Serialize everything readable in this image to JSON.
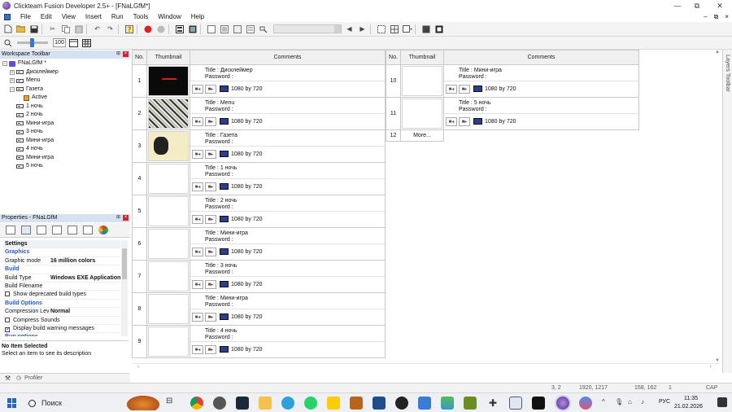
{
  "window": {
    "title": "Clickteam Fusion Developer 2.5+ - [FNaLGfM*]",
    "controls": {
      "minimize": "—",
      "restore": "⧉",
      "close": "✕"
    }
  },
  "menu": [
    "File",
    "Edit",
    "View",
    "Insert",
    "Run",
    "Tools",
    "Window",
    "Help"
  ],
  "mdi_controls": {
    "minimize": "–",
    "restore": "⧉",
    "close": "×"
  },
  "toolbar2": {
    "zoom_value": "100"
  },
  "workspace": {
    "title": "Workspace Toolbar",
    "tree": [
      {
        "label": "FNaLGfM *",
        "type": "app",
        "expander": "−",
        "indent": 0
      },
      {
        "label": "Дисклеймер",
        "type": "frame",
        "expander": "+",
        "indent": 1
      },
      {
        "label": "Menu",
        "type": "frame",
        "expander": "+",
        "indent": 1
      },
      {
        "label": "Газета",
        "type": "frame",
        "expander": "−",
        "indent": 1
      },
      {
        "label": "Active",
        "type": "active",
        "expander": "",
        "indent": 2
      },
      {
        "label": "1 ночь",
        "type": "frame",
        "expander": "",
        "indent": 1
      },
      {
        "label": "2 ночь",
        "type": "frame",
        "expander": "",
        "indent": 1
      },
      {
        "label": "Мини-игра",
        "type": "frame",
        "expander": "",
        "indent": 1
      },
      {
        "label": "3 ночь",
        "type": "frame",
        "expander": "",
        "indent": 1
      },
      {
        "label": "Мини-игра",
        "type": "frame",
        "expander": "",
        "indent": 1
      },
      {
        "label": "4 ночь",
        "type": "frame",
        "expander": "",
        "indent": 1
      },
      {
        "label": "Мини-игра",
        "type": "frame",
        "expander": "",
        "indent": 1
      },
      {
        "label": "5 ночь",
        "type": "frame",
        "expander": "",
        "indent": 1
      }
    ]
  },
  "properties": {
    "title": "Properties - FNaLGfM",
    "rows": [
      {
        "kind": "category",
        "label": "Settings"
      },
      {
        "kind": "sub",
        "label": "Graphics"
      },
      {
        "kind": "prop",
        "name": "Graphic mode",
        "value": "16 million colors"
      },
      {
        "kind": "sub",
        "label": "Build"
      },
      {
        "kind": "prop",
        "name": "Build Type",
        "value": "Windows EXE Application"
      },
      {
        "kind": "prop",
        "name": "Build Filename",
        "value": ""
      },
      {
        "kind": "check",
        "label": "Show deprecated build types",
        "checked": false
      },
      {
        "kind": "sub",
        "label": "Build Options"
      },
      {
        "kind": "prop",
        "name": "Compression Lev",
        "value": "Normal"
      },
      {
        "kind": "check",
        "label": "Compress Sounds",
        "checked": false
      },
      {
        "kind": "check",
        "label": "Display build warning messages",
        "checked": true
      },
      {
        "kind": "sub",
        "label": "Run options"
      }
    ],
    "desc_title": "No Item Selected",
    "desc_text": "Select an item to see its description"
  },
  "bottom_left": {
    "profiler_label": "Profiler"
  },
  "storyboard": {
    "headers": {
      "no": "No.",
      "thumbnail": "Thumbnail",
      "comments": "Comments"
    },
    "title_prefix": "Title : ",
    "password_label": "Password :",
    "left_frames": [
      {
        "no": "1",
        "title": "Дисклеймер",
        "size": "1080 by 720",
        "thumb": "dark"
      },
      {
        "no": "2",
        "title": "Menu",
        "size": "1080 by 720",
        "thumb": "menu"
      },
      {
        "no": "3",
        "title": "Газета",
        "size": "1080 by 720",
        "thumb": "paper"
      },
      {
        "no": "4",
        "title": "1 ночь",
        "size": "1080 by 720",
        "thumb": "empty"
      },
      {
        "no": "5",
        "title": "2 ночь",
        "size": "1080 by 720",
        "thumb": "empty"
      },
      {
        "no": "6",
        "title": "Мини-игра",
        "size": "1080 by 720",
        "thumb": "empty"
      },
      {
        "no": "7",
        "title": "3 ночь",
        "size": "1080 by 720",
        "thumb": "empty"
      },
      {
        "no": "8",
        "title": "Мини-игра",
        "size": "1080 by 720",
        "thumb": "empty"
      },
      {
        "no": "9",
        "title": "4 ночь",
        "size": "1080 by 720",
        "thumb": "empty"
      }
    ],
    "right_frames": [
      {
        "no": "10",
        "title": "Мини-игра",
        "size": "1080 by 720",
        "thumb": "empty"
      },
      {
        "no": "11",
        "title": "5 ночь",
        "size": "1080 by 720",
        "thumb": "empty"
      }
    ],
    "more_row": {
      "no": "12",
      "label": "More..."
    }
  },
  "layers_toolbar": {
    "label": "Layers Toolbar"
  },
  "status": {
    "coord": "3, 2",
    "size1": "1920, 1217",
    "size2": "158, 162",
    "count": "1",
    "keys": "CAP NUM"
  },
  "taskbar": {
    "search_placeholder": "Поиск",
    "language": "РУС",
    "time": "11:35",
    "date": "21.02.2026"
  }
}
